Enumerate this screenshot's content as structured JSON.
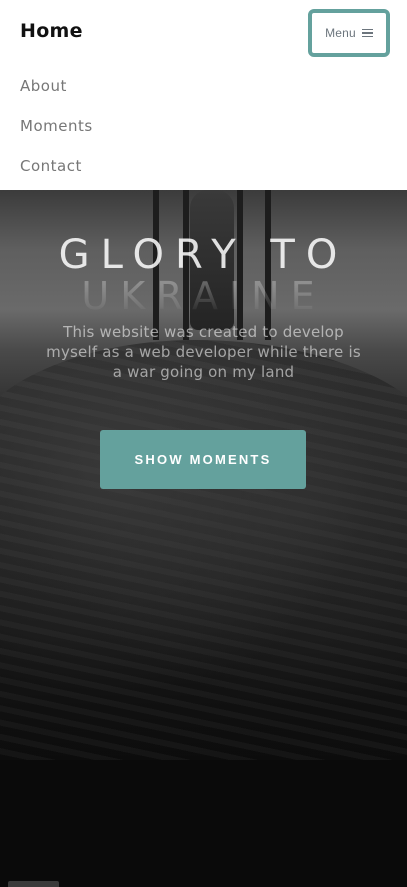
{
  "navbar": {
    "brand": "Home",
    "menu_label": "Menu",
    "menu_icon": "bars-icon",
    "links": [
      {
        "label": "About"
      },
      {
        "label": "Moments"
      },
      {
        "label": "Contact"
      }
    ]
  },
  "hero": {
    "title": "GLORY TO",
    "subtitle": "UKRAINE",
    "description": "This website was created to develop myself as a web developer while there is a war going on my land",
    "cta_label": "SHOW MOMENTS"
  },
  "colors": {
    "accent": "#64a19d",
    "navbar_bg": "#ffffff",
    "page_bg": "#0b0b0b"
  }
}
